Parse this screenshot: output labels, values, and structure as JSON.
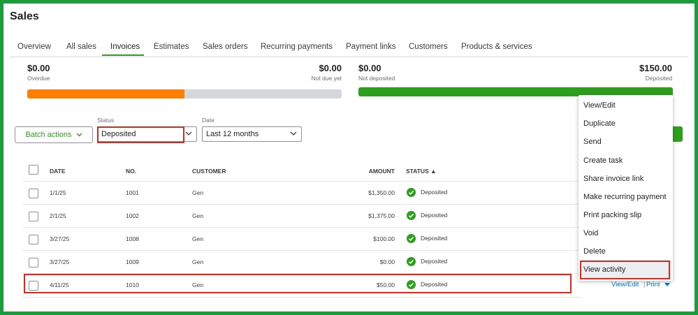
{
  "page": {
    "title": "Sales"
  },
  "tabs": [
    "Overview",
    "All sales",
    "Invoices",
    "Estimates",
    "Sales orders",
    "Recurring payments",
    "Payment links",
    "Customers",
    "Products & services"
  ],
  "active_tab": "Invoices",
  "summary": {
    "overdue_amount": "$0.00",
    "overdue_label": "Overdue",
    "not_due_amount": "$0.00",
    "not_due_label": "Not due yet",
    "not_deposited_amount": "$0.00",
    "not_deposited_label": "Not deposited",
    "deposited_amount": "$150.00",
    "deposited_label": "Deposited",
    "overdue_fraction": 0.5,
    "deposited_fraction": 1.0
  },
  "filters": {
    "batch_actions": "Batch actions",
    "status_label": "Status",
    "status_value": "Deposited",
    "date_label": "Date",
    "date_value": "Last 12 months"
  },
  "table": {
    "headers": {
      "date": "DATE",
      "no": "NO.",
      "customer": "CUSTOMER",
      "amount": "AMOUNT",
      "status": "STATUS ▲"
    },
    "rows": [
      {
        "date": "1/1/25",
        "no": "1001",
        "customer": "Gen",
        "amount": "$1,350.00",
        "status": "Deposited"
      },
      {
        "date": "2/1/25",
        "no": "1002",
        "customer": "Gen",
        "amount": "$1,375.00",
        "status": "Deposited"
      },
      {
        "date": "3/27/25",
        "no": "1008",
        "customer": "Gen",
        "amount": "$100.00",
        "status": "Deposited"
      },
      {
        "date": "3/27/25",
        "no": "1009",
        "customer": "Gen",
        "amount": "$0.00",
        "status": "Deposited"
      },
      {
        "date": "4/11/25",
        "no": "1010",
        "customer": "Gen",
        "amount": "$50.00",
        "status": "Deposited"
      }
    ],
    "row_actions": {
      "view_edit": "View/Edit",
      "separator": "|",
      "print": "Print"
    }
  },
  "menu": [
    "View/Edit",
    "Duplicate",
    "Send",
    "Create task",
    "Share invoice link",
    "Make recurring payment",
    "Print packing slip",
    "Void",
    "Delete",
    "View activity"
  ],
  "colors": {
    "brand_green": "#2ca01c",
    "overdue_orange": "#ff8000",
    "highlight_red": "#d52b1e",
    "link_blue": "#0077c5"
  }
}
